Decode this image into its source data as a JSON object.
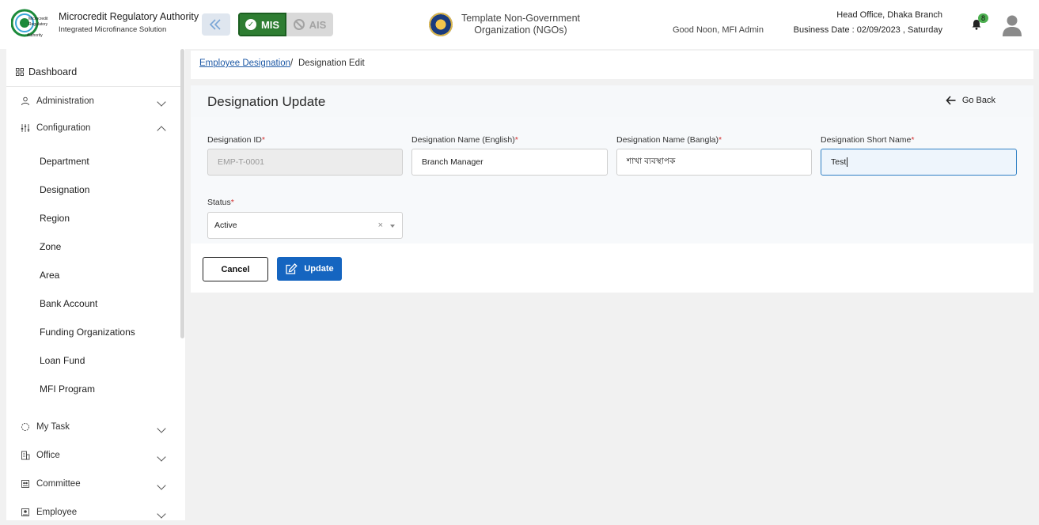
{
  "header": {
    "brand_title": "Microcredit Regulatory Authority",
    "brand_subtitle": "Integrated Microfinance Solution",
    "logo_text": [
      "Microcredit",
      "Regulatory",
      "Authority"
    ],
    "mode_mis": "MIS",
    "mode_ais": "AIS",
    "org_name_line1": "Template Non-Government",
    "org_name_line2": "Organization (NGOs)",
    "greeting": "Good Noon, MFI Admin",
    "branch": "Head Office, Dhaka Branch",
    "business_date": "Business Date : 02/09/2023 , Saturday",
    "notification_count": "8",
    "accent_green": "#2e7d32"
  },
  "sidebar": {
    "dashboard": "Dashboard",
    "groups": [
      {
        "label": "Administration",
        "icon": "users-icon",
        "expanded": false
      },
      {
        "label": "Configuration",
        "icon": "sliders-icon",
        "expanded": true
      }
    ],
    "config_items": [
      "Department",
      "Designation",
      "Region",
      "Zone",
      "Area",
      "Bank Account",
      "Funding Organizations",
      "Loan Fund",
      "MFI Program"
    ],
    "bottom_groups": [
      {
        "label": "My Task",
        "icon": "task-icon"
      },
      {
        "label": "Office",
        "icon": "office-icon"
      },
      {
        "label": "Committee",
        "icon": "committee-icon"
      },
      {
        "label": "Employee",
        "icon": "employee-icon"
      }
    ]
  },
  "breadcrumb": {
    "parent": "Employee Designation",
    "separator": "/",
    "current": "Designation Edit"
  },
  "form": {
    "title": "Designation Update",
    "go_back": "Go Back",
    "fields": {
      "designation_id": {
        "label": "Designation ID",
        "value": "EMP-T-0001"
      },
      "name_english": {
        "label": "Designation Name (English)",
        "value": "Branch Manager"
      },
      "name_bangla": {
        "label": "Designation Name (Bangla)",
        "value": "শাখা ব্যবস্থাপক"
      },
      "short_name": {
        "label": "Designation Short Name",
        "value": "Test"
      },
      "status": {
        "label": "Status",
        "value": "Active",
        "clear": "×"
      }
    },
    "required_mark": "*",
    "cancel": "Cancel",
    "update": "Update",
    "primary_color": "#1565c0"
  }
}
